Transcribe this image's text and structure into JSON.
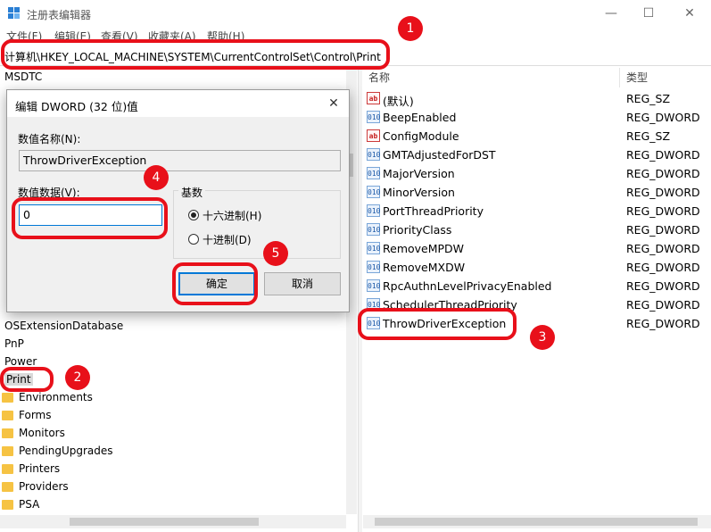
{
  "window": {
    "title": "注册表编辑器",
    "minimize": "—",
    "maximize": "☐",
    "close": "✕"
  },
  "menu": [
    "文件(F)",
    "编辑(E)",
    "查看(V)",
    "收藏夹(A)",
    "帮助(H)"
  ],
  "address": "计算机\\HKEY_LOCAL_MACHINE\\SYSTEM\\CurrentControlSet\\Control\\Print",
  "tree": {
    "top_item": "MSDTC",
    "items": [
      "OSExtensionDatabase",
      "PnP",
      "Power",
      "Print"
    ],
    "selected": "Print",
    "children": [
      "Environments",
      "Forms",
      "Monitors",
      "PendingUpgrades",
      "Printers",
      "Providers",
      "PSA"
    ]
  },
  "list": {
    "columns": {
      "name": "名称",
      "type": "类型"
    },
    "rows": [
      {
        "name": "(默认)",
        "type": "REG_SZ",
        "icon": "ab"
      },
      {
        "name": "BeepEnabled",
        "type": "REG_DWORD",
        "icon": "010"
      },
      {
        "name": "ConfigModule",
        "type": "REG_SZ",
        "icon": "ab"
      },
      {
        "name": "GMTAdjustedForDST",
        "type": "REG_DWORD",
        "icon": "010"
      },
      {
        "name": "MajorVersion",
        "type": "REG_DWORD",
        "icon": "010"
      },
      {
        "name": "MinorVersion",
        "type": "REG_DWORD",
        "icon": "010"
      },
      {
        "name": "PortThreadPriority",
        "type": "REG_DWORD",
        "icon": "010"
      },
      {
        "name": "PriorityClass",
        "type": "REG_DWORD",
        "icon": "010"
      },
      {
        "name": "RemoveMPDW",
        "type": "REG_DWORD",
        "icon": "010"
      },
      {
        "name": "RemoveMXDW",
        "type": "REG_DWORD",
        "icon": "010"
      },
      {
        "name": "RpcAuthnLevelPrivacyEnabled",
        "type": "REG_DWORD",
        "icon": "010"
      },
      {
        "name": "SchedulerThreadPriority",
        "type": "REG_DWORD",
        "icon": "010"
      },
      {
        "name": "ThrowDriverException",
        "type": "REG_DWORD",
        "icon": "010"
      }
    ]
  },
  "dialog": {
    "title": "编辑 DWORD (32 位)值",
    "close": "✕",
    "name_label": "数值名称(N):",
    "name_value": "ThrowDriverException",
    "data_label": "数值数据(V):",
    "data_value": "0",
    "base_label": "基数",
    "hex_label": "十六进制(H)",
    "dec_label": "十进制(D)",
    "ok_label": "确定",
    "cancel_label": "取消"
  },
  "annotations": [
    "1",
    "2",
    "3",
    "4",
    "5"
  ],
  "colors": {
    "highlight": "#e8101a",
    "folder": "#f6c343",
    "focus": "#0078d7"
  }
}
